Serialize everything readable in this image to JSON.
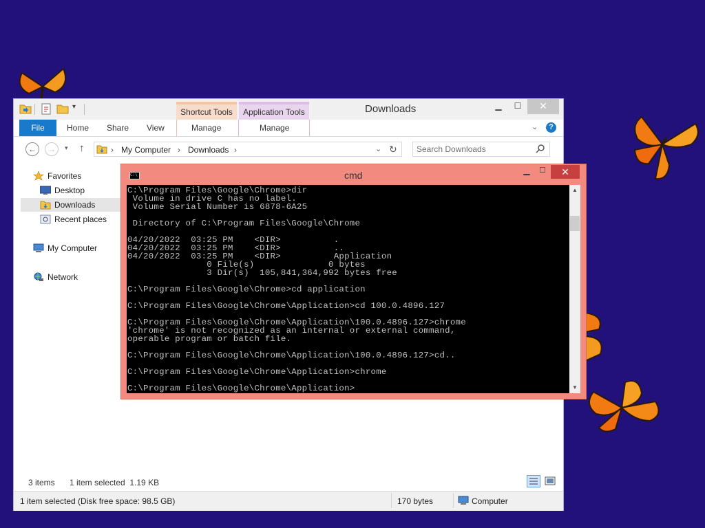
{
  "explorer": {
    "title": "Downloads",
    "context_tabs": [
      "Shortcut Tools",
      "Application Tools"
    ],
    "ribbon_tabs": [
      "File",
      "Home",
      "Share",
      "View",
      "Manage",
      "Manage"
    ],
    "breadcrumb": [
      "My Computer",
      "Downloads"
    ],
    "search_placeholder": "Search Downloads",
    "nav": {
      "favorites": "Favorites",
      "desktop": "Desktop",
      "downloads": "Downloads",
      "recent": "Recent places",
      "computer": "My Computer",
      "network": "Network"
    },
    "items_count": "3 items",
    "selection": "1 item selected  1.19 KB",
    "status_left": "1 item selected (Disk free space: 98.5 GB)",
    "status_size": "170 bytes",
    "status_location": "Computer"
  },
  "cmd": {
    "title": "cmd",
    "console_lines": [
      "C:\\Program Files\\Google\\Chrome>dir",
      " Volume in drive C has no label.",
      " Volume Serial Number is 6878-6A25",
      "",
      " Directory of C:\\Program Files\\Google\\Chrome",
      "",
      "04/20/2022  03:25 PM    <DIR>          .",
      "04/20/2022  03:25 PM    <DIR>          ..",
      "04/20/2022  03:25 PM    <DIR>          Application",
      "               0 File(s)              0 bytes",
      "               3 Dir(s)  105,841,364,992 bytes free",
      "",
      "C:\\Program Files\\Google\\Chrome>cd application",
      "",
      "C:\\Program Files\\Google\\Chrome\\Application>cd 100.0.4896.127",
      "",
      "C:\\Program Files\\Google\\Chrome\\Application\\100.0.4896.127>chrome",
      "'chrome' is not recognized as an internal or external command,",
      "operable program or batch file.",
      "",
      "C:\\Program Files\\Google\\Chrome\\Application\\100.0.4896.127>cd..",
      "",
      "C:\\Program Files\\Google\\Chrome\\Application>chrome",
      "",
      "C:\\Program Files\\Google\\Chrome\\Application>"
    ]
  },
  "colors": {
    "desktop": "#22117a",
    "cmd_frame": "#f28a7f",
    "file_tab": "#1979ca"
  }
}
